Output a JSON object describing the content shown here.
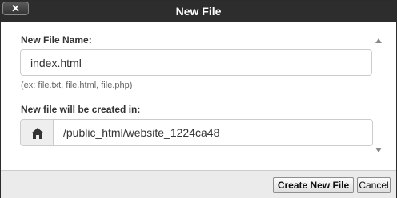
{
  "dialog": {
    "title": "New File",
    "close_label": "✕"
  },
  "form": {
    "file_name_label": "New File Name:",
    "file_name_value": "index.html",
    "file_name_hint": "(ex: file.txt, file.html, file.php)",
    "directory_label": "New file will be created in:",
    "directory_value": "/public_html/website_1224ca48",
    "directory_icon": "home-icon"
  },
  "footer": {
    "create_label": "Create New File",
    "cancel_label": "Cancel"
  },
  "colors": {
    "titlebar": "#2d2d2d",
    "footer": "#ebebeb",
    "border": "#cccccc"
  }
}
